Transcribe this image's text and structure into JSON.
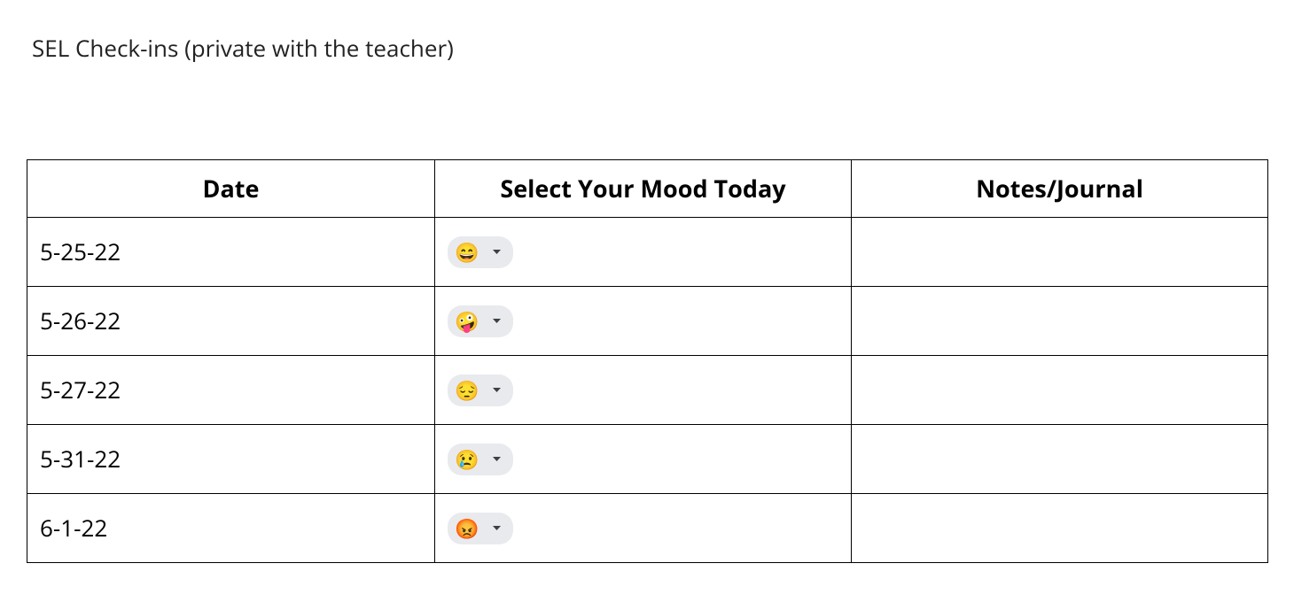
{
  "title": "SEL Check-ins (private with the teacher)",
  "table": {
    "headers": {
      "date": "Date",
      "mood": "Select Your Mood Today",
      "notes": "Notes/Journal"
    },
    "rows": [
      {
        "date": "5-25-22",
        "mood_emoji": "😄",
        "mood_name": "beaming-face",
        "notes": ""
      },
      {
        "date": "5-26-22",
        "mood_emoji": "🤪",
        "mood_name": "zany-face",
        "notes": ""
      },
      {
        "date": "5-27-22",
        "mood_emoji": "😔",
        "mood_name": "pensive-face",
        "notes": ""
      },
      {
        "date": "5-31-22",
        "mood_emoji": "😢",
        "mood_name": "crying-face",
        "notes": ""
      },
      {
        "date": "6-1-22",
        "mood_emoji": "😡",
        "mood_name": "pouting-face",
        "notes": ""
      }
    ]
  }
}
